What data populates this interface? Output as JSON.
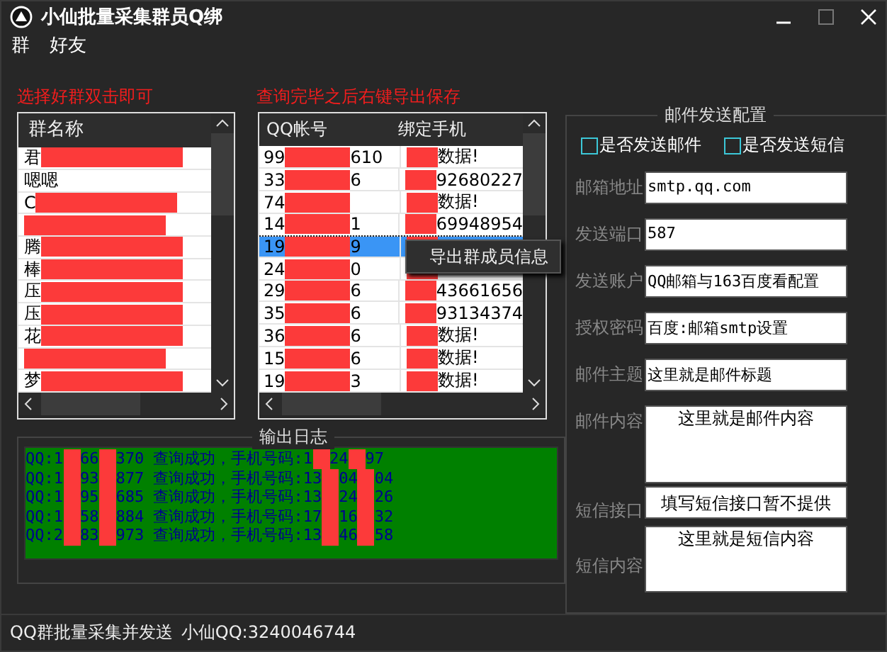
{
  "window": {
    "title": "小仙批量采集群员Q绑"
  },
  "menu": [
    "群",
    "好友"
  ],
  "hints": [
    "选择好群双击即可",
    "查询完毕之后右键导出保存"
  ],
  "groups": {
    "column": "群名称",
    "rows": [
      {
        "text": "君",
        "redacted": true
      },
      {
        "text": "嗯嗯",
        "redacted": false
      },
      {
        "text": "C",
        "redacted": true
      },
      {
        "redacted": true
      },
      {
        "text": "腾",
        "redacted": true
      },
      {
        "text": "棒",
        "redacted": true
      },
      {
        "text": "压",
        "redacted": true
      },
      {
        "text": "压",
        "redacted": true
      },
      {
        "text": "花",
        "redacted": true
      },
      {
        "redacted": true
      },
      {
        "text": "梦",
        "redacted": true
      }
    ]
  },
  "members": {
    "columns": [
      "QQ帐号",
      "绑定手机"
    ],
    "rows": [
      {
        "qq": [
          "99",
          "610"
        ],
        "phone": "数据!",
        "selected": false
      },
      {
        "qq": [
          "33",
          "6"
        ],
        "phone": "92680227",
        "selected": false
      },
      {
        "qq": [
          "74"
        ],
        "phone": "数据!",
        "selected": false
      },
      {
        "qq": [
          "14",
          "1"
        ],
        "phone": "69948954",
        "selected": false
      },
      {
        "qq": [
          "19",
          "9"
        ],
        "phone": "",
        "selected": true
      },
      {
        "qq": [
          "24",
          "0"
        ],
        "phone": "",
        "selected": false
      },
      {
        "qq": [
          "29",
          "6"
        ],
        "phone": "43661656",
        "selected": false
      },
      {
        "qq": [
          "35",
          "6"
        ],
        "phone": "93134374",
        "selected": false
      },
      {
        "qq": [
          "36",
          "6"
        ],
        "phone": "数据!",
        "selected": false
      },
      {
        "qq": [
          "15",
          "6"
        ],
        "phone": "数据!",
        "selected": false
      },
      {
        "qq": [
          "19",
          "3"
        ],
        "phone": "数据!",
        "selected": false
      }
    ]
  },
  "context_menu": {
    "items": [
      "导出群成员信息"
    ]
  },
  "config": {
    "title": "邮件发送配置",
    "checkboxes": [
      {
        "label": "是否发送邮件",
        "checked": false
      },
      {
        "label": "是否发送短信",
        "checked": false
      }
    ],
    "fields": [
      {
        "label": "邮箱地址",
        "value": "smtp.qq.com",
        "kind": "line"
      },
      {
        "label": "发送端口",
        "value": "587",
        "kind": "line"
      },
      {
        "label": "发送账户",
        "value": "QQ邮箱与163百度看配置",
        "kind": "line"
      },
      {
        "label": "授权密码",
        "value": "百度:邮箱smtp设置",
        "kind": "line"
      },
      {
        "label": "邮件主题",
        "value": "这里就是邮件标题",
        "kind": "line"
      },
      {
        "label": "邮件内容",
        "value": "这里就是邮件内容",
        "kind": "area"
      },
      {
        "label": "短信接口",
        "value": "填写短信接口暂不提供",
        "kind": "center"
      },
      {
        "label": "短信内容",
        "value": "这里就是短信内容",
        "kind": "area2"
      }
    ]
  },
  "log": {
    "title": "输出日志",
    "lines": [
      [
        "QQ:1",
        "66",
        "370 查询成功，手机号码:1",
        "24",
        "97"
      ],
      [
        "QQ:1",
        "93",
        "877 查询成功，手机号码:13",
        "04",
        "04"
      ],
      [
        "QQ:1",
        "95",
        "685 查询成功，手机号码:13",
        "24",
        "26"
      ],
      [
        "QQ:1",
        "58",
        "884 查询成功，手机号码:17",
        "16",
        "32"
      ],
      [
        "QQ:2",
        "83",
        "973 查询成功，手机号码:13",
        "46",
        "58"
      ]
    ]
  },
  "status_bar": [
    "QQ群批量采集并发送",
    "小仙QQ:3240046744"
  ]
}
